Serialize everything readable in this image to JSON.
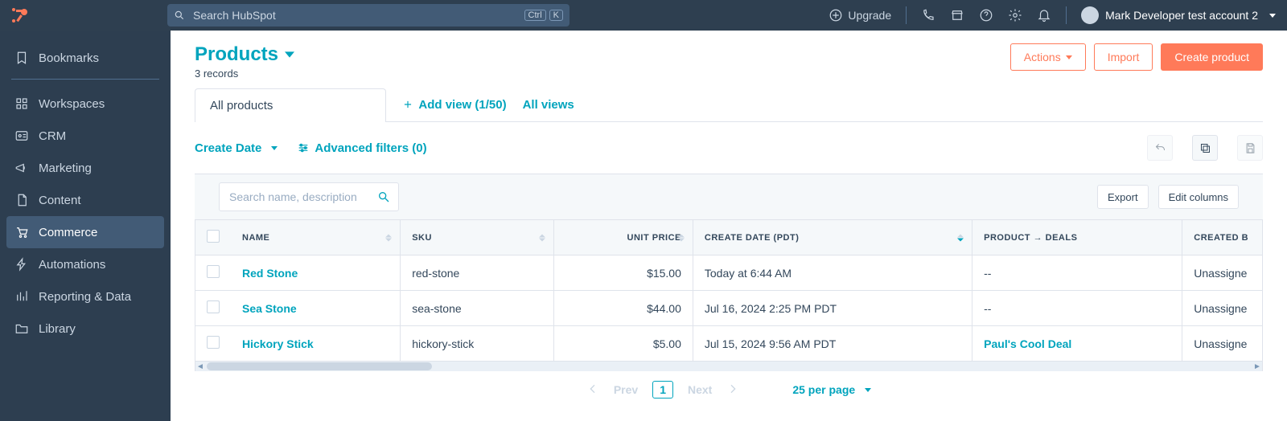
{
  "topbar": {
    "search_placeholder": "Search HubSpot",
    "kbd1": "Ctrl",
    "kbd2": "K",
    "upgrade_label": "Upgrade",
    "account_name": "Mark Developer test account 2"
  },
  "sidebar": {
    "items": [
      {
        "label": "Bookmarks",
        "icon": "bookmark"
      },
      {
        "label": "Workspaces",
        "icon": "grid"
      },
      {
        "label": "CRM",
        "icon": "id"
      },
      {
        "label": "Marketing",
        "icon": "megaphone"
      },
      {
        "label": "Content",
        "icon": "file"
      },
      {
        "label": "Commerce",
        "icon": "cart",
        "active": true
      },
      {
        "label": "Automations",
        "icon": "bolt"
      },
      {
        "label": "Reporting & Data",
        "icon": "bars"
      },
      {
        "label": "Library",
        "icon": "folder"
      }
    ]
  },
  "page": {
    "title": "Products",
    "subtitle": "3 records",
    "actions_label": "Actions",
    "import_label": "Import",
    "create_label": "Create product"
  },
  "tabs": {
    "active_tab": "All products",
    "add_view_label": "Add view (1/50)",
    "all_views_label": "All views"
  },
  "filters": {
    "create_date_label": "Create Date",
    "advanced_label": "Advanced filters (0)"
  },
  "table_bar": {
    "search_placeholder": "Search name, description",
    "export_label": "Export",
    "edit_cols_label": "Edit columns"
  },
  "columns": {
    "name": "Name",
    "sku": "SKU",
    "unit_price": "Unit Price",
    "create_date": "Create Date (PDT)",
    "deals": "Product → Deals",
    "created_by": "Created b"
  },
  "rows": [
    {
      "name": "Red Stone",
      "sku": "red-stone",
      "price": "$15.00",
      "created": "Today at 6:44 AM",
      "deal": "--",
      "createdby": "Unassigne"
    },
    {
      "name": "Sea Stone",
      "sku": "sea-stone",
      "price": "$44.00",
      "created": "Jul 16, 2024 2:25 PM PDT",
      "deal": "--",
      "createdby": "Unassigne"
    },
    {
      "name": "Hickory Stick",
      "sku": "hickory-stick",
      "price": "$5.00",
      "created": "Jul 15, 2024 9:56 AM PDT",
      "deal": "Paul's Cool Deal",
      "createdby": "Unassigne"
    }
  ],
  "pager": {
    "prev": "Prev",
    "page": "1",
    "next": "Next",
    "per_page": "25 per page"
  }
}
